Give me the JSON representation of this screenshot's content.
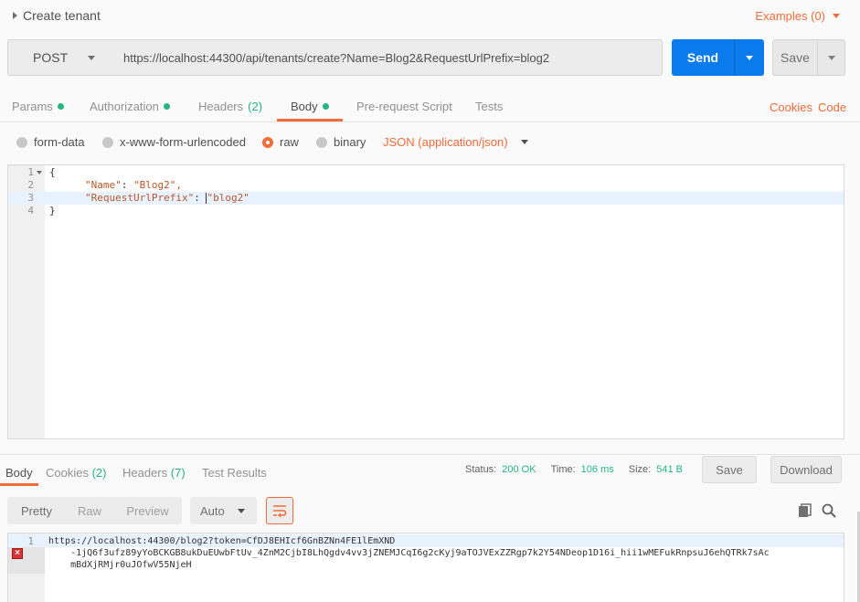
{
  "request": {
    "title": "Create tenant",
    "examples_label": "Examples (0)",
    "method": "POST",
    "url": "https://localhost:44300/api/tenants/create?Name=Blog2&RequestUrlPrefix=blog2",
    "send_label": "Send",
    "save_label": "Save"
  },
  "request_tabs": {
    "params": "Params",
    "authorization": "Authorization",
    "headers": "Headers",
    "headers_count": "(2)",
    "body": "Body",
    "pre_request": "Pre-request Script",
    "tests": "Tests",
    "cookies": "Cookies",
    "code": "Code"
  },
  "body_types": {
    "form_data": "form-data",
    "urlencoded": "x-www-form-urlencoded",
    "raw": "raw",
    "binary": "binary",
    "selected": "raw",
    "content_type": "JSON (application/json)"
  },
  "editor": {
    "lines": [
      {
        "n": "1",
        "text": "{"
      },
      {
        "n": "2",
        "key": "\"Name\"",
        "value": "\"Blog2\","
      },
      {
        "n": "3",
        "key": "\"RequestUrlPrefix\"",
        "value": "\"blog2\""
      },
      {
        "n": "4",
        "text": "}"
      }
    ]
  },
  "response_tabs": {
    "body": "Body",
    "cookies": "Cookies",
    "cookies_count": "(2)",
    "headers": "Headers",
    "headers_count": "(7)",
    "test_results": "Test Results"
  },
  "response_meta": {
    "status_label": "Status:",
    "status_value": "200 OK",
    "time_label": "Time:",
    "time_value": "106 ms",
    "size_label": "Size:",
    "size_value": "541 B",
    "save_label": "Save",
    "download_label": "Download"
  },
  "response_toolbar": {
    "pretty": "Pretty",
    "raw": "Raw",
    "preview": "Preview",
    "format": "Auto"
  },
  "response_body": {
    "line_number": "1",
    "text": "https://localhost:44300/blog2?token=CfDJ8EHIcf6GnBZNn4FE1lEmXND\n    -1jQ6f3ufz89yYoBCKGB8ukDuEUwbFtUv_4ZnM2CjbI8LhQgdv4vv3jZNEMJCqI6g2cKyj9aTOJVExZZRgp7k2Y54NDeop1D16i_hii1wMEFukRnpsuJ6ehQTRk7sAc\n    mBdXjRMjr0uJOfwV55NjeH"
  },
  "colors": {
    "accent": "#f26b3a",
    "send_blue": "#097bed",
    "success_green": "#26b47f"
  }
}
